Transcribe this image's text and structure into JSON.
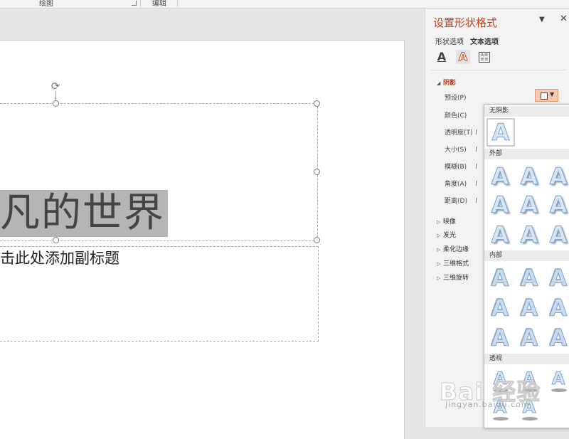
{
  "ribbon": {
    "group_drawing": "绘图",
    "group_editing": "编辑"
  },
  "slide": {
    "title_text": "凡的世界",
    "subtitle_placeholder": "击此处添加副标题"
  },
  "pane": {
    "title": "设置形状格式",
    "dropdown_glyph": "▼",
    "close_glyph": "✕",
    "tabs": [
      {
        "label": "形状选项"
      },
      {
        "label": "文本选项",
        "active": true
      }
    ],
    "icons": [
      "text-fill-outline-icon",
      "text-effects-icon",
      "textbox-layout-icon"
    ],
    "shadow_section": {
      "label": "阴影",
      "expanded": true,
      "properties": {
        "preset": "预设(P)",
        "color": "颜色(C)",
        "transparency": "透明度(T)",
        "size": "大小(S)",
        "blur": "模糊(B)",
        "angle": "角度(A)",
        "distance": "距离(D)"
      }
    },
    "collapsed_sections": {
      "reflection": "映像",
      "glow": "发光",
      "soft_edges": "柔化边缘",
      "format_3d": "三维格式",
      "rotation_3d": "三维旋转"
    },
    "accent_color": "#c2401c"
  },
  "gallery": {
    "headers": {
      "no_shadow": "无阴影",
      "outer": "外部",
      "inner": "内部",
      "perspective": "透视"
    },
    "glyph": "A"
  },
  "watermark": {
    "brand": "Bai  经验",
    "url": "jingyan.baidu.com"
  }
}
